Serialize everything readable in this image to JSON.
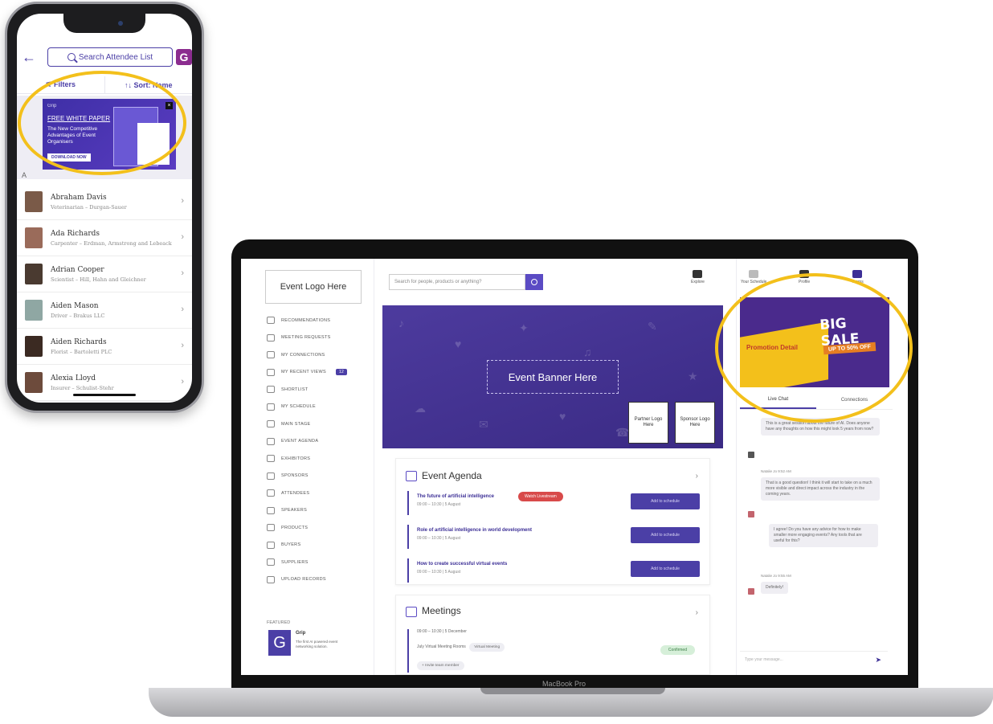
{
  "phone": {
    "search_placeholder": "Search Attendee List",
    "logo_letter": "G",
    "filters_label": "⚟ Filters",
    "sort_label": "↑↓ Sort: Name",
    "ad": {
      "brand": "Grip",
      "headline": "FREE WHITE PAPER",
      "subtitle": "The New Competitive Advantages of Event Organisers",
      "cta": "DOWNLOAD NOW",
      "close": "×"
    },
    "section_letter": "A",
    "attendees": [
      {
        "name": "Abraham Davis",
        "role": "Veterinarian – Durgan-Sauer"
      },
      {
        "name": "Ada Richards",
        "role": "Carpenter – Erdman, Armstrong and Lebeack"
      },
      {
        "name": "Adrian Cooper",
        "role": "Scientist – Hill, Hahn and Gleichner"
      },
      {
        "name": "Aiden Mason",
        "role": "Driver – Brakus LLC"
      },
      {
        "name": "Aiden Richards",
        "role": "Florist – Bartoletti PLC"
      },
      {
        "name": "Alexia Lloyd",
        "role": "Insurer – Schulist-Stehr"
      }
    ]
  },
  "laptop": {
    "event_logo": "Event Logo Here",
    "search_placeholder": "Search for people, products or anything?",
    "nav": [
      {
        "label": "RECOMMENDATIONS"
      },
      {
        "label": "MEETING REQUESTS"
      },
      {
        "label": "MY CONNECTIONS"
      },
      {
        "label": "MY RECENT VIEWS",
        "badge": "12"
      },
      {
        "label": "SHORTLIST"
      },
      {
        "label": "MY SCHEDULE"
      },
      {
        "label": "MAIN STAGE"
      },
      {
        "label": "EVENT AGENDA"
      },
      {
        "label": "EXHIBITORS"
      },
      {
        "label": "SPONSORS"
      },
      {
        "label": "ATTENDEES"
      },
      {
        "label": "SPEAKERS"
      },
      {
        "label": "PRODUCTS"
      },
      {
        "label": "BUYERS"
      },
      {
        "label": "SUPPLIERS"
      },
      {
        "label": "UPLOAD RECORDS"
      }
    ],
    "featured": {
      "label": "FEATURED",
      "logo": "G",
      "name": "Grip",
      "desc": "The first AI powered event networking solution."
    },
    "top_nav": [
      {
        "label": "Explore"
      },
      {
        "label": "Your Schedule"
      },
      {
        "label": "Profile"
      },
      {
        "label": "Teams"
      }
    ],
    "banner": {
      "text": "Event Banner Here",
      "partner": "Partner Logo Here",
      "sponsor": "Sponsor Logo Here"
    },
    "agenda": {
      "title": "Event Agenda",
      "live_label": "Watch Livestream",
      "items": [
        {
          "title": "The future of artificial intelligence",
          "time": "09:00 – 10:30 | 5 August",
          "button": "Add to schedule"
        },
        {
          "title": "Role of artificial intelligence in world development",
          "time": "09:00 – 10:30 | 5 August",
          "button": "Add to schedule"
        },
        {
          "title": "How to create successful virtual events",
          "time": "09:00 – 10:30 | 5 August",
          "button": "Add to schedule"
        }
      ]
    },
    "meetings": {
      "title": "Meetings",
      "time": "09:00 – 10:30 | 5 December",
      "room": "July Virtual Meeting Rooms",
      "type": "Virtual Meeting",
      "invite": "+ Invite team member",
      "status": "Confirmed"
    },
    "right_panel": {
      "ad_headline": "BIG SALE",
      "ad_promo": "Promotion Detail",
      "ad_offer": "UP TO 50% OFF",
      "tab_live": "Live Chat",
      "tab_connections": "Connections",
      "messages": [
        {
          "text": "This is a great session about the future of AI. Does anyone have any thoughts on how this might look 5 years from now?"
        },
        {
          "name": "Natalie Jo 9:52 AM",
          "text": "That is a good question! I think it will start to take on a much more visible and direct impact across the industry in the coming years."
        },
        {
          "text": "I agree! Do you have any advice for how to make smaller more engaging events? Any tools that are useful for this?"
        },
        {
          "name": "Natalie Jo 9:55 AM",
          "text": "Definitely!"
        }
      ],
      "input_placeholder": "Type your message..."
    },
    "model": "MacBook Pro"
  }
}
